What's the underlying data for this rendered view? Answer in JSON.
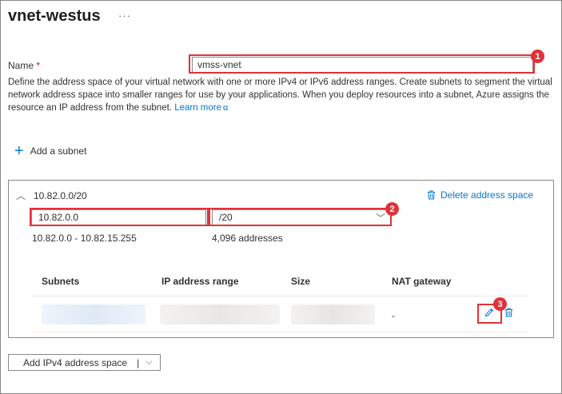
{
  "header": {
    "title": "vnet-westus",
    "more_label": "···"
  },
  "name_field": {
    "label": "Name",
    "required_mark": "*",
    "value": "vmss-vnet"
  },
  "description": {
    "text": "Define the address space of your virtual network with one or more IPv4 or IPv6 address ranges. Create subnets to segment the virtual network address space into smaller ranges for use by your applications. When you deploy resources into a subnet, Azure assigns the resource an IP address from the subnet.",
    "link": "Learn more",
    "link_icon": "external-link-icon"
  },
  "add_subnet": {
    "label": "Add a subnet",
    "icon": "plus-icon"
  },
  "address_space": {
    "label": "10.82.0.0/20",
    "delete_label": "Delete address space",
    "address_value": "10.82.0.0",
    "prefix_value": "/20",
    "range": "10.82.0.0 - 10.82.15.255",
    "count": "4,096 addresses"
  },
  "subnets_table": {
    "headers": {
      "subnets": "Subnets",
      "ip_range": "IP address range",
      "size": "Size",
      "nat": "NAT gateway"
    },
    "rows": [
      {
        "nat": "-"
      }
    ]
  },
  "add_ipv4": {
    "label": "Add IPv4 address space",
    "separator": "|",
    "chevron": "⌵"
  },
  "annotations": {
    "badge1": "1",
    "badge2": "2",
    "badge3": "3"
  },
  "colors": {
    "accent": "#0078d4",
    "highlight": "#e0323a",
    "required": "#a4262c"
  }
}
